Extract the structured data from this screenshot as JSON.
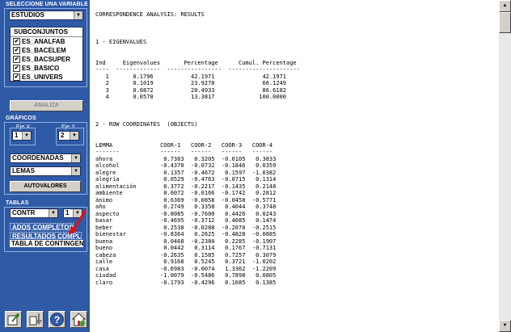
{
  "sidebar": {
    "variable_frame_label": "SELECCIONE UNA VARIABLE",
    "variable_select": "ESTUDIOS",
    "subsets_header": "SUBCONJUNTOS",
    "subsets": [
      {
        "label": "ES_ANALFAB",
        "checked": true
      },
      {
        "label": "ES_BACELEM",
        "checked": true
      },
      {
        "label": "ES_BACSUPER",
        "checked": true
      },
      {
        "label": "ES_BASICO",
        "checked": true
      },
      {
        "label": "ES_UNIVERS",
        "checked": true
      }
    ],
    "check_mark": "✔",
    "analyze_button": "ANALIZA",
    "graphics_frame_label": "GRÁFICOS",
    "axis_x_label": "Eje X",
    "axis_x_value": "1",
    "axis_y_label": "Eje Y",
    "axis_y_value": "2",
    "coords_select": "COORDENADAS",
    "lemmas_select": "LEMAS",
    "eigenvalues_button": "AUTOVALORES",
    "tables_frame_label": "TABLAS",
    "contr_select": "CONTR",
    "contr_num_select": "1",
    "options": [
      {
        "label": "ADOS COMPLETOS",
        "selected": true
      },
      {
        "label": "RESULTADOS COMPLE",
        "selected": true
      },
      {
        "label": "TABLA DE CONTINGEN",
        "selected": false
      }
    ]
  },
  "toolbar_icons": [
    "export-icon",
    "import-icon",
    "help-icon",
    "home-icon"
  ],
  "colors": {
    "sidebar_bg": "#2f5aa6",
    "pointer_red": "#e01010"
  },
  "report": {
    "title": "CORRESPONDENCE ANALYSIS: RESULTS",
    "section1_title": "1 - EIGENVALUES",
    "eigen_header": "Ind     Eigenvalues       Percentage      Cumul. Percentage",
    "eigen_sep": "----  -------------  ----------------  ---------------------",
    "eigen_rows": [
      "   1       0.1796           42.1971              42.1971",
      "   2       0.1019           23.9278              66.1249",
      "   3       0.0872           20.4933              86.6182",
      "   4       0.0570           13.3817             100.0000"
    ],
    "section2_title": "2 - ROW COORDINATES  (OBJECTS)",
    "coord_header": "LEMMA              COOR-1   COOR-2   COOR-3   COOR-4",
    "coord_sep": "-------            ------   ------   ------   ------",
    "coord_rows": [
      "ahora               0.7383   0.3205  -0.0105   0.3833",
      "alcohol            -0.4370  -0.0732  -0.1846   0.0359",
      "alegre              0.1357  -0.4672   0.1597  -1.0382",
      "alegría             0.0529  -0.4763  -0.0715   0.1314",
      "alimentación        0.3772  -0.2217  -0.1435   0.2148",
      "ambiente            0.6072  -0.0166  -0.1742   0.2812",
      "ánimo               0.6369  -0.0858  -0.0458  -0.5771",
      "año                 0.2749   0.3358   0.4044   0.3748",
      "aspecto            -0.8085  -0.7600   0.4426   0.0243",
      "basar              -0.4695  -0.3712   0.4685   0.1474",
      "beber               0.2538  -0.0288  -0.2070  -0.2515",
      "bienestar          -0.8364   0.2625  -0.4828  -0.0885",
      "buena               0.0468  -0.2380   0.2285  -0.1907",
      "bueno               0.0442   0.3114   0.1767  -0.7131",
      "cabeza             -0.2635   0.1585   0.7257   0.3079",
      "calle               0.9168   0.5245   0.3721  -1.0202",
      "casa               -0.6983  -0.0074   1.3362  -1.2209",
      "ciudad             -1.0079  -0.5486   0.7898   0.0805",
      "claro              -0.1793  -0.4296   0.1685   0.1385"
    ]
  }
}
